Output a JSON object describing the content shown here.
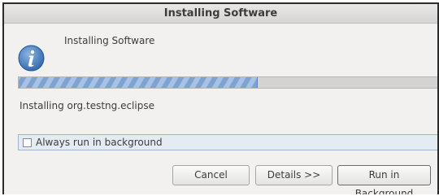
{
  "window": {
    "title": "Installing Software"
  },
  "header": {
    "text": "Installing Software",
    "icon": "info-icon"
  },
  "progress": {
    "fraction": 0.57
  },
  "task": {
    "text": "Installing org.testng.eclipse"
  },
  "options": {
    "always_background_label": "Always run in background",
    "always_background_checked": false
  },
  "buttons": {
    "cancel": "Cancel",
    "details": "Details >>",
    "run_in_background": "Run in Background"
  },
  "colors": {
    "progress_fill": "#7fa3d1",
    "info_icon": "#3a72b5"
  }
}
